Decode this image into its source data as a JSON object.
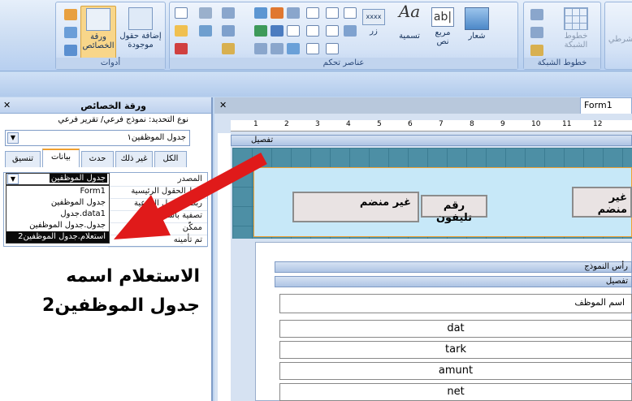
{
  "ribbon": {
    "groups": [
      {
        "caption": "أدوات"
      },
      {
        "caption": "عناصر تحكم"
      },
      {
        "caption": "خطوط الشبكة"
      }
    ],
    "tools": {
      "property_sheet": "ورقة الخصائص",
      "add_fields": "إضافة حقول موجودة"
    },
    "controls": {
      "image": "شعار",
      "textbox": "مربع نص",
      "label": "تسمية",
      "button": "زر"
    },
    "gridlines": {
      "gridlines_label": "خطوط الشبكة",
      "conditional": "شرطي"
    }
  },
  "property_sheet": {
    "title": "ورقة الخصائص",
    "selection_type": "نوع التحديد:  نموذج فرعي/ تقرير فرعي",
    "object": "جدول الموظفين١",
    "tabs": [
      "تنسيق",
      "بيانات",
      "حدث",
      "غير ذلك",
      "الكل"
    ],
    "rows": [
      "المصدر",
      "ربط الحقول الرئيسية",
      "ربط الحقول الفرعية",
      "تصفية باستخدام",
      "ممكّن",
      "تم تأمينه"
    ],
    "source_value": "جدول الموظفين",
    "dropdown_items": [
      "Form1",
      "جدول الموظفين",
      "جدول.data1",
      "جدول.جدول الموظفين",
      "استعلام.جدول الموظفين2"
    ],
    "selected_index": 4
  },
  "annotation": {
    "line1": "الاستعلام اسمه",
    "line2": "جدول الموظفين2"
  },
  "form": {
    "tab": "Form1",
    "detail_band": "تفصيل",
    "header_band": "رأس النموذج",
    "detail_band2": "تفصيل",
    "label_na1": "غير منضم",
    "label_phone": "رقم تليفون",
    "label_na2": "غير منضم",
    "field_caption": "اسم الموظف",
    "fields": [
      "dat",
      "tark",
      "amunt",
      "net"
    ],
    "ruler_numbers": [
      "1",
      "2",
      "3",
      "4",
      "5",
      "6",
      "7",
      "8",
      "9",
      "10",
      "11",
      "12"
    ]
  }
}
